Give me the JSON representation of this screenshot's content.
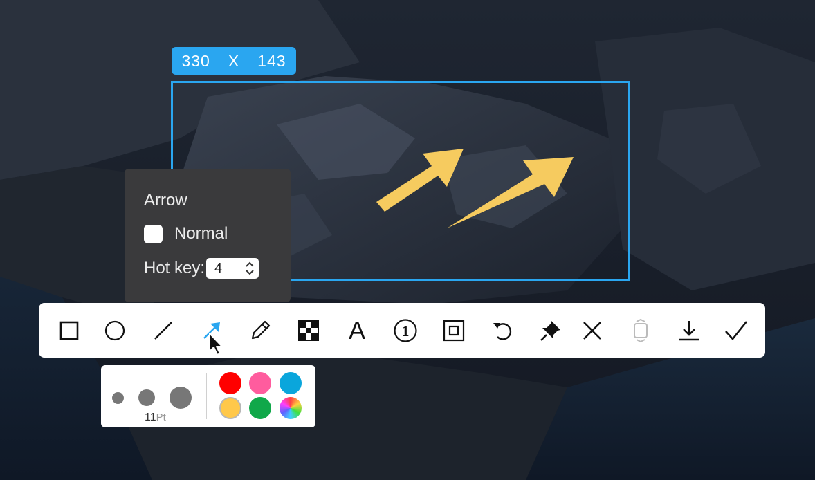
{
  "size_badge": {
    "width": "330",
    "sep": "X",
    "height": "143"
  },
  "arrow_panel": {
    "title": "Arrow",
    "normal_label": "Normal",
    "hotkey_label": "Hot key:",
    "hotkey_value": "4"
  },
  "toolbar": {
    "tools": [
      "rectangle-icon",
      "ellipse-icon",
      "line-icon",
      "arrow-icon",
      "pencil-icon",
      "mosaic-icon",
      "text-icon",
      "number-marker-icon",
      "border-icon",
      "undo-icon",
      "pin-icon",
      "close-icon",
      "scroll-capture-icon",
      "download-icon",
      "confirm-icon"
    ],
    "selected": "arrow-icon",
    "text_tool_glyph": "A",
    "number_tool_glyph": "1"
  },
  "pen_panel": {
    "size_value": "11",
    "size_unit": "Pt",
    "colors": [
      "#ff0000",
      "#ff5c9e",
      "#0aa6dc",
      "#ffc84a",
      "#10a84a",
      "rainbow"
    ]
  },
  "colors": {
    "accent": "#2aa6f0",
    "annotation_arrow": "#f6cb5f",
    "panel_dark": "#3a3a3c"
  }
}
